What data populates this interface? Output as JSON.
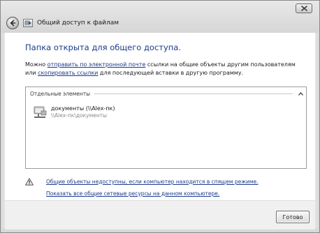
{
  "window": {
    "title": "Общий доступ к файлам"
  },
  "main": {
    "heading": "Папка открыта для общего доступа.",
    "description": {
      "part1": "Можно ",
      "link_email": "отправить по электронной почте",
      "part2": " ссылки на общие объекты другим пользователям или ",
      "link_copy": "скопировать ссылки",
      "part3": " для последующей вставки в другую программу."
    },
    "group": {
      "label": "Отдельные элементы",
      "items": [
        {
          "name": "документы (\\\\Alex-пк)",
          "path": "\\\\Alex-пк\\документы",
          "icon": "network-folder-icon"
        }
      ]
    },
    "warning_link": "Общие объекты недоступны, если компьютер находится в спящем режиме.",
    "show_all_link": "Показать все общие сетевые ресурсы на данном компьютере."
  },
  "footer": {
    "ok_label": "Готово"
  }
}
